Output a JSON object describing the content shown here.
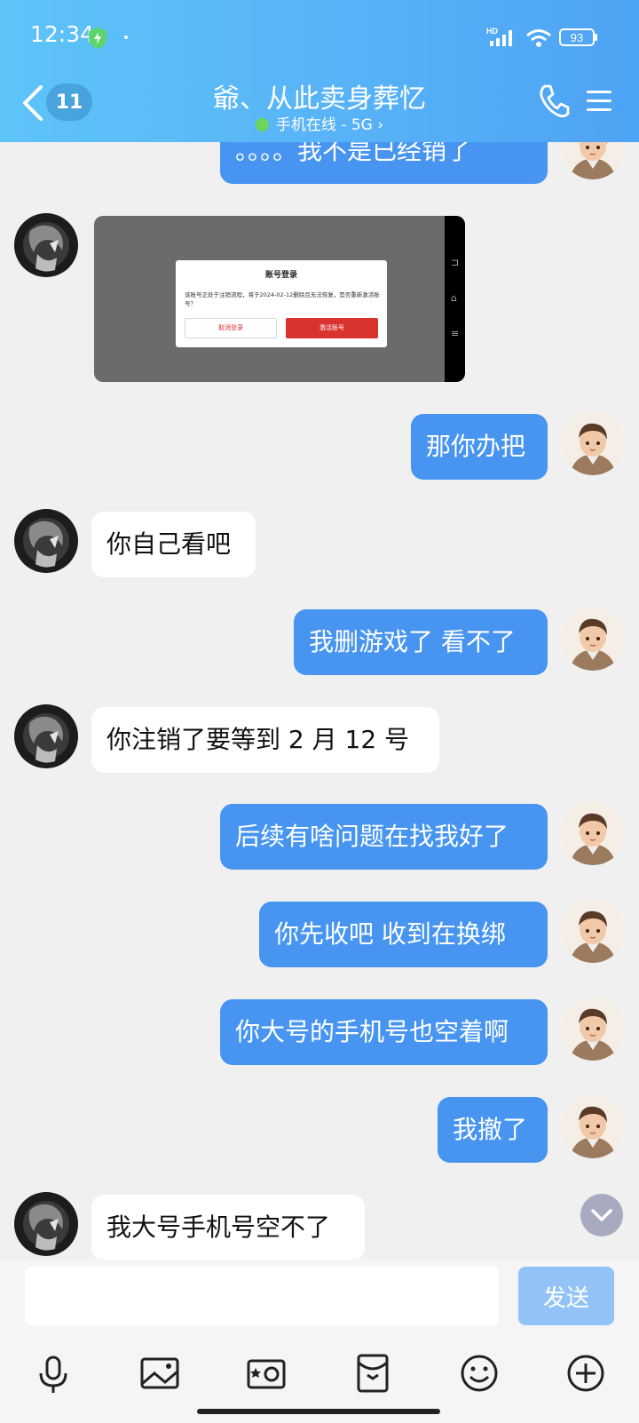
{
  "status_bar": {
    "time": "12:34",
    "network": "HD",
    "battery": "93"
  },
  "header": {
    "unread_count": "11",
    "title": "爺、从此卖身葬忆",
    "online_status": "手机在线 - 5G",
    "online_chevron": "›"
  },
  "messages": [
    {
      "side": "out",
      "text": "。。。。我不是已经销了"
    },
    {
      "side": "in",
      "type": "image",
      "dialog": {
        "title": "账号登录",
        "body": "该账号正处于注销流程，将于2024-02-12删除且无法恢复，是否重新激活账号？",
        "cancel": "取消登录",
        "activate": "激活账号"
      },
      "nav_icons": [
        "⊐",
        "⌂",
        "≡"
      ]
    },
    {
      "side": "out",
      "text": "那你办把"
    },
    {
      "side": "in",
      "text": "你自己看吧"
    },
    {
      "side": "out",
      "text": "我删游戏了 看不了"
    },
    {
      "side": "in",
      "text": "你注销了要等到 2 月 12 号"
    },
    {
      "side": "out",
      "text": "后续有啥问题在找我好了"
    },
    {
      "side": "out",
      "text": "你先收吧  收到在换绑"
    },
    {
      "side": "out",
      "text": "你大号的手机号也空着啊"
    },
    {
      "side": "out",
      "text": "我撤了"
    },
    {
      "side": "in",
      "text": "我大号手机号空不了"
    }
  ],
  "input": {
    "value": "",
    "placeholder": "",
    "send_label": "发送"
  },
  "toolbar": [
    "microphone-icon",
    "image-icon",
    "camera-icon",
    "red-packet-icon",
    "emoji-icon",
    "plus-icon"
  ],
  "colors": {
    "header": "#58b4f7",
    "outgoing_bubble": "#4795f0",
    "incoming_bubble": "#ffffff",
    "send_button": "#93c3f6",
    "dialog_activate": "#d8332f"
  }
}
